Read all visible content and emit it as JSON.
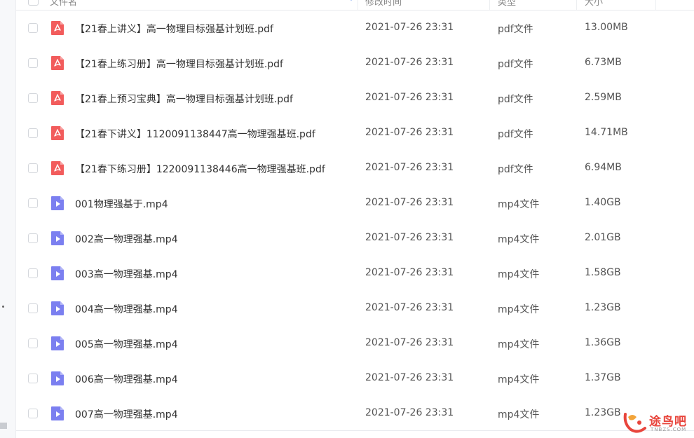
{
  "header": {
    "col_name": "文件名",
    "col_modified": "修改时间",
    "col_type": "类型",
    "col_size": "大小"
  },
  "colors": {
    "pdf_icon": "#f25c5c",
    "mp4_icon": "#7b7ff0",
    "watermark": "#e8453c"
  },
  "files": [
    {
      "name": "【21春上讲义】高一物理目标强基计划班.pdf",
      "modified": "2021-07-26 23:31",
      "type": "pdf文件",
      "size": "13.00MB",
      "icon": "pdf-icon"
    },
    {
      "name": "【21春上练习册】高一物理目标强基计划班.pdf",
      "modified": "2021-07-26 23:31",
      "type": "pdf文件",
      "size": "6.73MB",
      "icon": "pdf-icon"
    },
    {
      "name": "【21春上预习宝典】高一物理目标强基计划班.pdf",
      "modified": "2021-07-26 23:31",
      "type": "pdf文件",
      "size": "2.59MB",
      "icon": "pdf-icon"
    },
    {
      "name": "【21春下讲义】1120091138447高一物理强基班.pdf",
      "modified": "2021-07-26 23:31",
      "type": "pdf文件",
      "size": "14.71MB",
      "icon": "pdf-icon"
    },
    {
      "name": "【21春下练习册】1220091138446高一物理强基班.pdf",
      "modified": "2021-07-26 23:31",
      "type": "pdf文件",
      "size": "6.94MB",
      "icon": "pdf-icon"
    },
    {
      "name": "001物理强基于.mp4",
      "modified": "2021-07-26 23:31",
      "type": "mp4文件",
      "size": "1.40GB",
      "icon": "video-icon"
    },
    {
      "name": "002高一物理强基.mp4",
      "modified": "2021-07-26 23:31",
      "type": "mp4文件",
      "size": "2.01GB",
      "icon": "video-icon"
    },
    {
      "name": "003高一物理强基.mp4",
      "modified": "2021-07-26 23:31",
      "type": "mp4文件",
      "size": "1.58GB",
      "icon": "video-icon"
    },
    {
      "name": "004高一物理强基.mp4",
      "modified": "2021-07-26 23:31",
      "type": "mp4文件",
      "size": "1.23GB",
      "icon": "video-icon"
    },
    {
      "name": "005高一物理强基.mp4",
      "modified": "2021-07-26 23:31",
      "type": "mp4文件",
      "size": "1.36GB",
      "icon": "video-icon"
    },
    {
      "name": "006高一物理强基.mp4",
      "modified": "2021-07-26 23:31",
      "type": "mp4文件",
      "size": "1.37GB",
      "icon": "video-icon"
    },
    {
      "name": "007高一物理强基.mp4",
      "modified": "2021-07-26 23:31",
      "type": "mp4文件",
      "size": "1.23GB",
      "icon": "video-icon"
    }
  ],
  "watermark": {
    "text": "途鸟吧",
    "sub": "TNBZS.COM"
  }
}
